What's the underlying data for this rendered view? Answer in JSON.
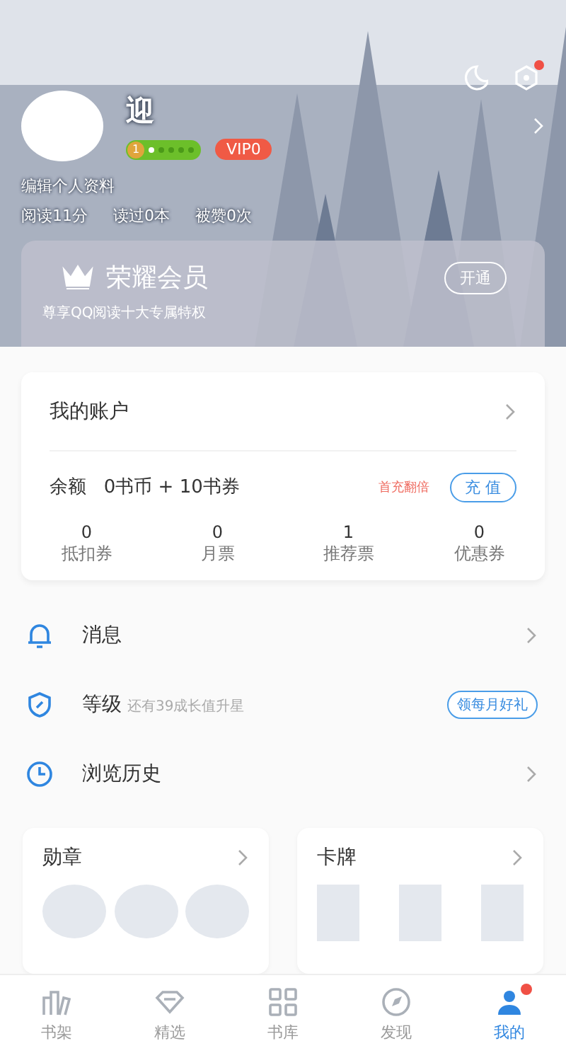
{
  "header": {
    "night_mode": true,
    "settings_dot": true
  },
  "profile": {
    "name": "迎",
    "level": "1",
    "stars": 1,
    "vip": "VIP0",
    "edit_link": "编辑个人资料",
    "stats": [
      "阅读11分",
      "读过0本",
      "被赞0次"
    ]
  },
  "vip_card": {
    "title": "荣耀会员",
    "subtitle": "尊享QQ阅读十大专属特权",
    "button": "开通"
  },
  "account": {
    "title": "我的账户",
    "balance_label": "余额",
    "balance": "0书币 + 10书券",
    "promo": "首充翻倍",
    "recharge": "充 值",
    "items": [
      {
        "value": "0",
        "label": "抵扣券"
      },
      {
        "value": "0",
        "label": "月票"
      },
      {
        "value": "1",
        "label": "推荐票"
      },
      {
        "value": "0",
        "label": "优惠券"
      }
    ]
  },
  "menu": [
    {
      "kind": "bell",
      "label": "消息"
    },
    {
      "kind": "shield",
      "label": "等级",
      "hint": "还有39成长值升星",
      "action": "领每月好礼"
    },
    {
      "kind": "clock",
      "label": "浏览历史"
    }
  ],
  "cards": [
    {
      "kind": "circles",
      "title": "勋章"
    },
    {
      "kind": "tiles",
      "title": "卡牌"
    }
  ],
  "tabs": [
    {
      "kind": "shelf",
      "label": "书架",
      "selected": false,
      "dot": false
    },
    {
      "kind": "gem",
      "label": "精选",
      "selected": false,
      "dot": false
    },
    {
      "kind": "grid",
      "label": "书库",
      "selected": false,
      "dot": false
    },
    {
      "kind": "compass",
      "label": "发现",
      "selected": false,
      "dot": false
    },
    {
      "kind": "person",
      "label": "我的",
      "selected": true,
      "dot": true
    }
  ]
}
